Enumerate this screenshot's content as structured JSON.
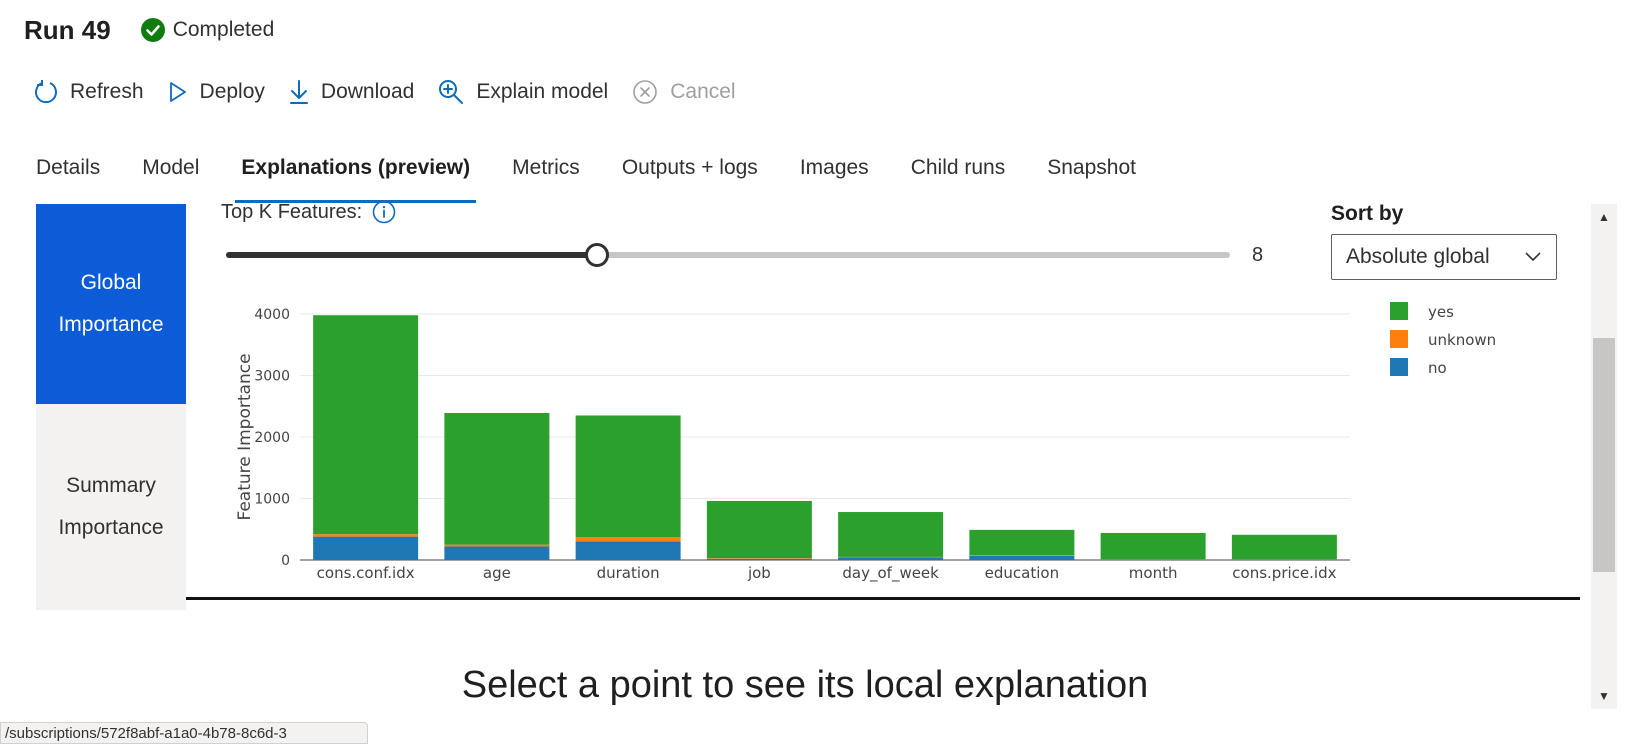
{
  "run": {
    "title": "Run 49",
    "status": "Completed"
  },
  "toolbar": {
    "refresh": "Refresh",
    "deploy": "Deploy",
    "download": "Download",
    "explain": "Explain model",
    "cancel": "Cancel"
  },
  "tabs": [
    {
      "label": "Details"
    },
    {
      "label": "Model"
    },
    {
      "label": "Explanations (preview)",
      "active": true
    },
    {
      "label": "Metrics"
    },
    {
      "label": "Outputs + logs"
    },
    {
      "label": "Images"
    },
    {
      "label": "Child runs"
    },
    {
      "label": "Snapshot"
    }
  ],
  "sidenav": {
    "global": "Global Importance",
    "summary": "Summary Importance"
  },
  "topk": {
    "label": "Top K Features:",
    "value": 8,
    "value_text": "8",
    "fraction": 0.37
  },
  "sort": {
    "label": "Sort by",
    "selected": "Absolute global"
  },
  "chart_data": {
    "type": "bar",
    "stacked": true,
    "ylabel": "Feature Importance",
    "xlabel": "",
    "ylim": [
      0,
      4000
    ],
    "yticks": [
      "4000",
      "3000",
      "2000",
      "1000",
      "0"
    ],
    "categories": [
      "cons.conf.idx",
      "age",
      "duration",
      "job",
      "day_of_week",
      "education",
      "month",
      "cons.price.idx"
    ],
    "series": [
      {
        "name": "no",
        "color": "#1f77b4",
        "values": [
          380,
          220,
          300,
          20,
          40,
          70,
          10,
          10
        ]
      },
      {
        "name": "unknown",
        "color": "#ff7f0e",
        "values": [
          40,
          30,
          70,
          10,
          10,
          10,
          5,
          5
        ]
      },
      {
        "name": "yes",
        "color": "#2ca02c",
        "values": [
          3560,
          2140,
          1980,
          930,
          730,
          410,
          425,
          395
        ]
      }
    ],
    "legend_order": [
      "yes",
      "unknown",
      "no"
    ],
    "legend_position": "top-right",
    "grid": true
  },
  "local_message": "Select a point to see its local explanation",
  "status_url": "/subscriptions/572f8abf-a1a0-4b78-8c6d-3"
}
